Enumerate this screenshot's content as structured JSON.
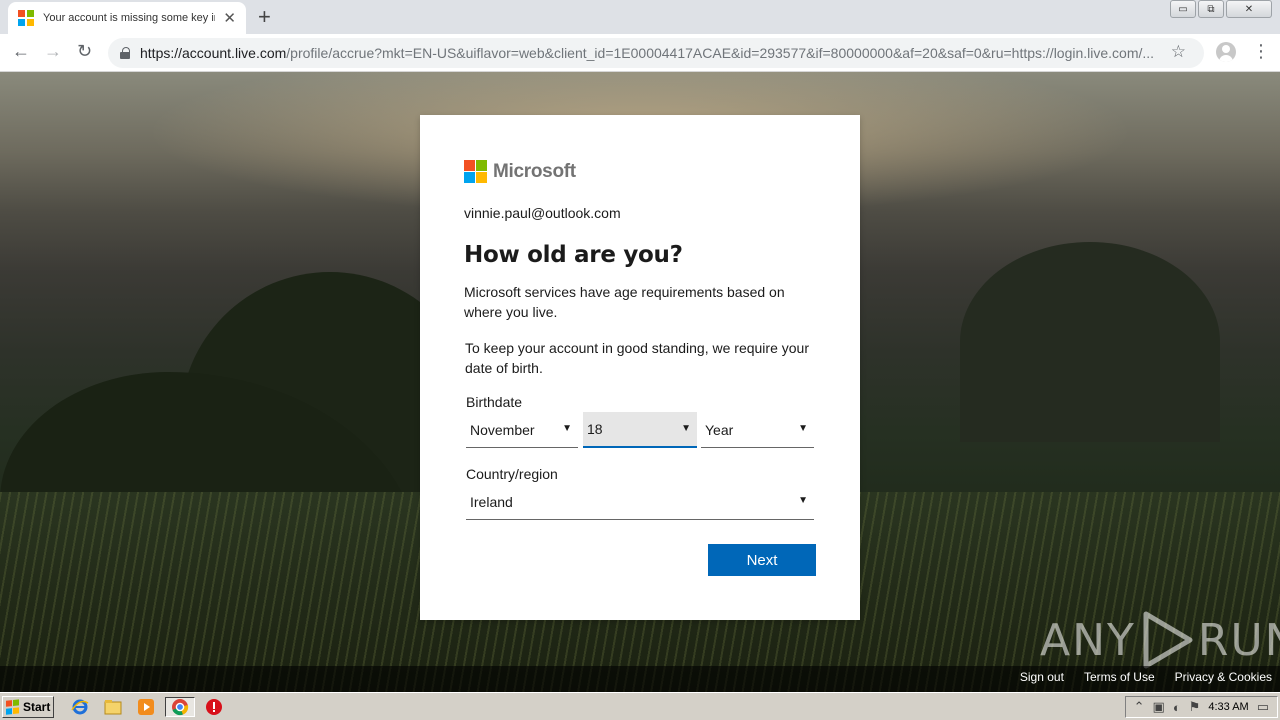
{
  "browser": {
    "tab_title": "Your account is missing some key inf",
    "tab_close": "✕",
    "new_tab": "+",
    "url_host": "https://account.live.com",
    "url_rest": "/profile/accrue?mkt=EN-US&uiflavor=web&client_id=1E00004417ACAE&id=293577&if=80000000&af=20&saf=0&ru=https://login.live.com/...",
    "window_buttons": {
      "minimize": "▭",
      "restore": "⧉",
      "close": "✕"
    },
    "nav": {
      "back": "←",
      "forward": "→",
      "reload": "↻"
    },
    "star": "☆",
    "menu": "⋮"
  },
  "card": {
    "brand": "Microsoft",
    "brand_colors": [
      "#f25022",
      "#7fba00",
      "#00a4ef",
      "#ffb900"
    ],
    "identity": "vinnie.paul@outlook.com",
    "heading": "How old are you?",
    "para1": "Microsoft services have age requirements based on where you live.",
    "para2": "To keep your account in good standing, we require your date of birth.",
    "birthdate_label": "Birthdate",
    "month": "November",
    "day": "18",
    "year": "Year",
    "country_label": "Country/region",
    "country": "Ireland",
    "arrow": "▼",
    "next": "Next",
    "accent": "#0067b8"
  },
  "watermark": {
    "left": "ANY",
    "right": "RUN"
  },
  "footer": {
    "sign_out": "Sign out",
    "terms": "Terms of Use",
    "privacy": "Privacy & Cookies"
  },
  "taskbar": {
    "start": "Start",
    "clock": "4:33 AM"
  }
}
